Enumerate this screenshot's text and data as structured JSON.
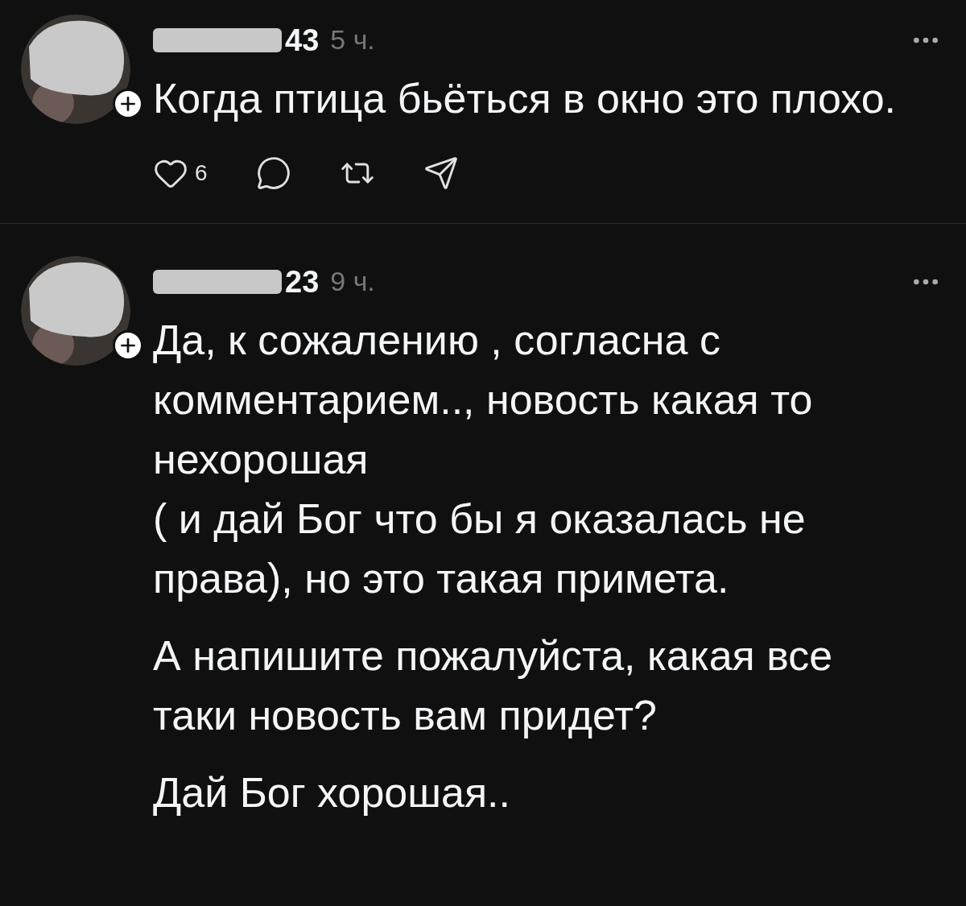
{
  "comments": [
    {
      "username": "43",
      "time": "5 ч.",
      "paragraphs": [
        "Когда птица бьёться в окно это плохо."
      ],
      "actions": {
        "likes": "6"
      }
    },
    {
      "username": "23",
      "time": "9 ч.",
      "paragraphs": [
        "Да, к сожалению , согласна с\nкомментарием.., новость какая то\nнехорошая\n( и дай Бог что бы я оказалась не\nправа), но это такая примета.",
        "А напишите пожалуйста, какая все\nтаки новость вам придет?",
        "Дай Бог хорошая.."
      ]
    }
  ]
}
